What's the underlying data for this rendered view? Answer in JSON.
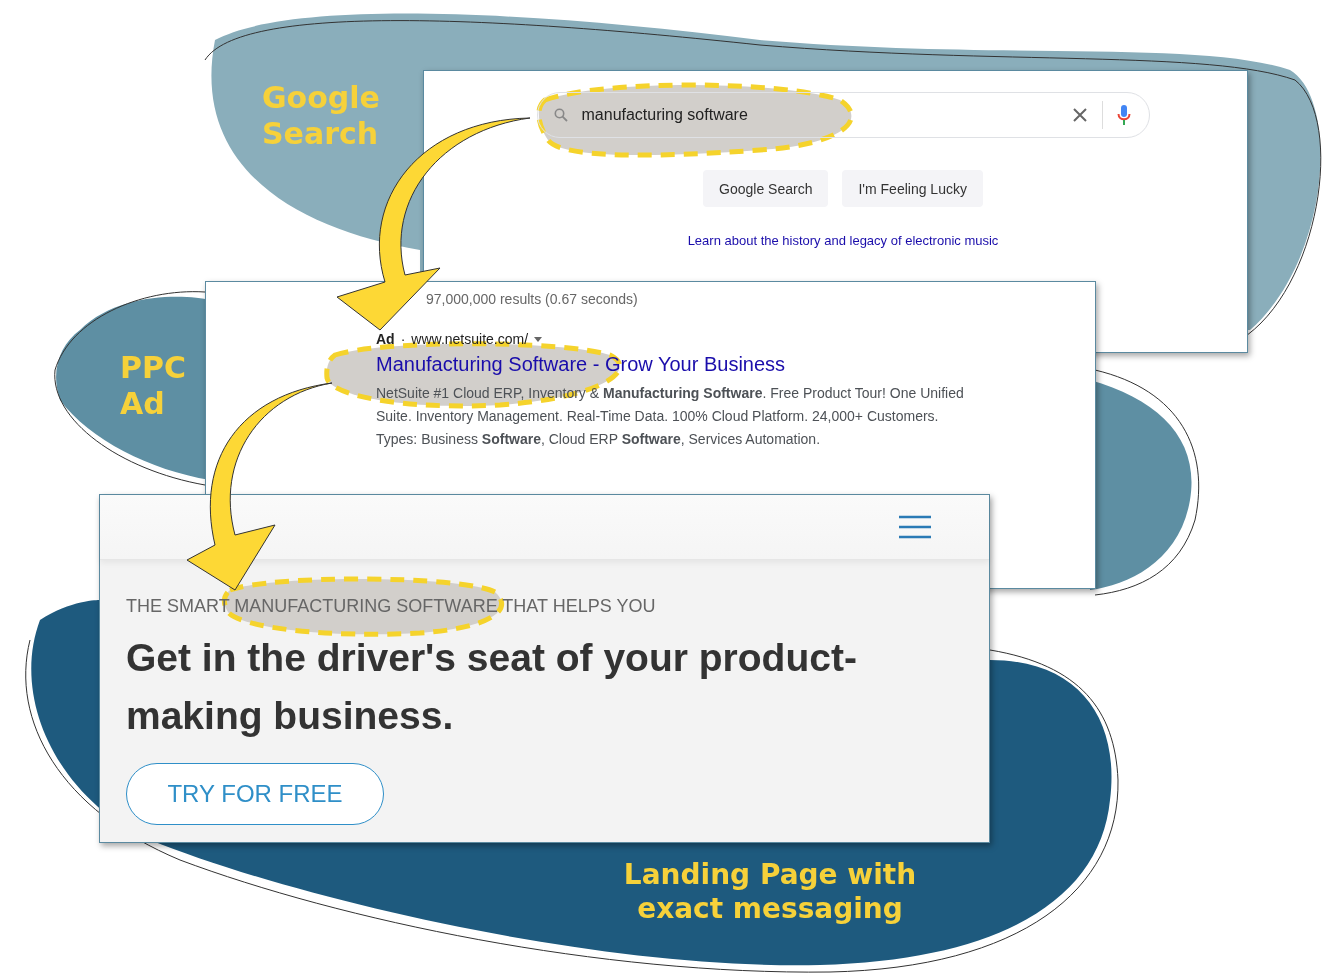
{
  "captions": [
    {
      "kind": "search",
      "text": "Google\nSearch"
    },
    {
      "kind": "ad",
      "text": "PPC\nAd"
    },
    {
      "kind": "landing",
      "text": "Landing Page with\nexact messaging"
    }
  ],
  "search_page": {
    "query": "manufacturing software",
    "buttons": [
      "Google Search",
      "I'm Feeling Lucky"
    ],
    "link": "Learn about the history and legacy of electronic music"
  },
  "results_page": {
    "results_count": "97,000,000 results (0.67 seconds)",
    "ad_label": "Ad",
    "separator": "·",
    "url": "www.netsuite.com/",
    "ad_title": "Manufacturing Software - Grow Your Business",
    "description": "NetSuite #1 Cloud ERP, Inventory & **Manufacturing Software**. Free Product Tour! One Unified Suite. Inventory Management. Real-Time Data. 100% Cloud Platform. 24,000+ Customers.",
    "types": "Types: Business **Software**, Cloud ERP **Software**, Services Automation."
  },
  "landing_page": {
    "eyebrow": "THE SMART MANUFACTURING SOFTWARE THAT HELPS YOU",
    "headline": "Get in the driver's seat of your product-making business.",
    "cta": "TRY FOR FREE"
  }
}
